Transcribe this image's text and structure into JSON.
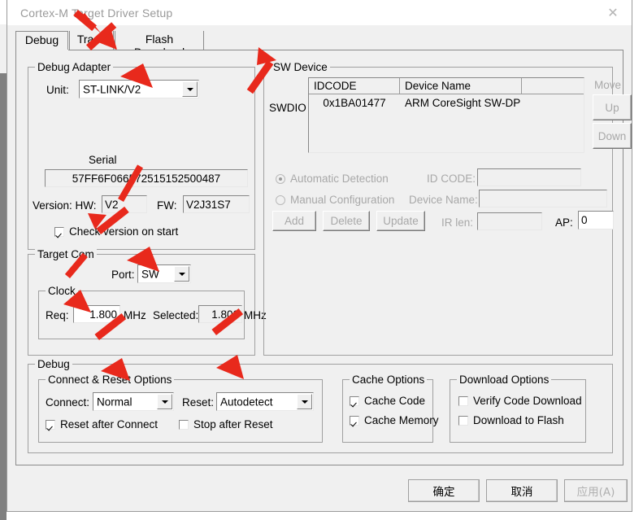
{
  "window": {
    "title": "Cortex-M Target Driver Setup",
    "close_icon": "close-icon",
    "close_glyph": "✕"
  },
  "tabs": [
    {
      "label": "Debug",
      "active": true
    },
    {
      "label": "Trace",
      "active": false
    },
    {
      "label": "Flash Download",
      "active": false
    }
  ],
  "debug_adapter": {
    "legend": "Debug Adapter",
    "unit_label": "Unit:",
    "unit_value": "ST-LINK/V2",
    "serial_label": "Serial",
    "serial_value": "57FF6F066572515152500487",
    "version_label": "Version: HW:",
    "hw_value": "V2",
    "fw_label": "FW:",
    "fw_value": "V2J31S7",
    "check_version_label": "Check version on start",
    "check_version_checked": true
  },
  "target_com": {
    "legend": "Target Com",
    "port_label": "Port:",
    "port_value": "SW",
    "clock_legend": "Clock",
    "req_label": "Req:",
    "req_value": "1.800",
    "req_unit": "MHz",
    "selected_label": "Selected:",
    "selected_value": "1.800",
    "selected_unit": "MHz"
  },
  "sw_device": {
    "legend": "SW Device",
    "swdio_label": "SWDIO",
    "columns": [
      "IDCODE",
      "Device Name",
      ""
    ],
    "rows": [
      {
        "idcode": "0x1BA01477",
        "device_name": "ARM CoreSight SW-DP"
      }
    ],
    "move_label": "Move",
    "up_label": "Up",
    "down_label": "Down",
    "automatic_detection_label": "Automatic Detection",
    "automatic_detection_selected": true,
    "manual_configuration_label": "Manual Configuration",
    "manual_configuration_selected": false,
    "id_code_label": "ID CODE:",
    "id_code_value": "",
    "device_name_label": "Device Name:",
    "device_name_value": "",
    "ir_len_label": "IR len:",
    "ir_len_value": "",
    "ap_label": "AP:",
    "ap_value": "0",
    "add_label": "Add",
    "delete_label": "Delete",
    "update_label": "Update"
  },
  "debug_section": {
    "legend": "Debug",
    "connect_reset": {
      "legend": "Connect & Reset Options",
      "connect_label": "Connect:",
      "connect_value": "Normal",
      "reset_label": "Reset:",
      "reset_value": "Autodetect",
      "reset_after_connect_label": "Reset after Connect",
      "reset_after_connect_checked": true,
      "stop_after_reset_label": "Stop after Reset",
      "stop_after_reset_checked": false
    },
    "cache_options": {
      "legend": "Cache Options",
      "cache_code_label": "Cache Code",
      "cache_code_checked": true,
      "cache_memory_label": "Cache Memory",
      "cache_memory_checked": true
    },
    "download_options": {
      "legend": "Download Options",
      "verify_code_download_label": "Verify Code Download",
      "verify_code_download_checked": false,
      "download_to_flash_label": "Download to Flash",
      "download_to_flash_checked": false
    }
  },
  "footer": {
    "ok_label": "确定",
    "cancel_label": "取消",
    "apply_label": "应用(A)",
    "apply_disabled": true
  },
  "annotations": {
    "color": "#e8291c",
    "arrows": [
      {
        "name": "arrow-to-debug-tab"
      },
      {
        "name": "arrow-to-trace-tab"
      },
      {
        "name": "arrow-to-unit-combo"
      },
      {
        "name": "arrow-to-check-version"
      },
      {
        "name": "arrow-to-port-combo"
      },
      {
        "name": "arrow-to-req-field"
      },
      {
        "name": "arrow-to-connect-reset-options"
      },
      {
        "name": "arrow-to-reset-combo"
      }
    ]
  }
}
